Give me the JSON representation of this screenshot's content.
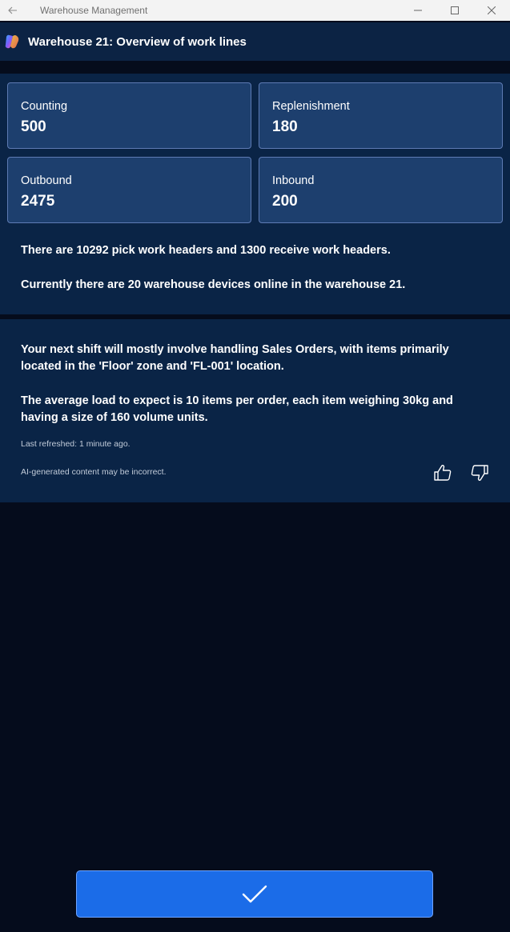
{
  "titlebar": {
    "title": "Warehouse Management",
    "back_icon": "arrow-left-icon",
    "minimize_icon": "minimize-icon",
    "maximize_icon": "maximize-icon",
    "close_icon": "close-icon"
  },
  "header": {
    "title": "Warehouse 21: Overview of work lines",
    "logo_icon": "copilot-logo"
  },
  "stats": [
    {
      "label": "Counting",
      "value": "500"
    },
    {
      "label": "Replenishment",
      "value": "180"
    },
    {
      "label": "Outbound",
      "value": "2475"
    },
    {
      "label": "Inbound",
      "value": "200"
    }
  ],
  "summary": {
    "line1": "There are 10292 pick work headers and 1300 receive work headers.",
    "line2": "Currently there are 20 warehouse devices online in the warehouse 21."
  },
  "insight": {
    "para1": "Your next shift will mostly involve handling Sales Orders, with items primarily located in the 'Floor' zone and 'FL-001' location.",
    "para2": "The average load to expect is 10 items per order, each item weighing 30kg and having a size of 160 volume units.",
    "last_refreshed": "Last refreshed: 1 minute ago.",
    "disclaimer": "AI-generated content may be incorrect.",
    "thumbs_up_icon": "thumbs-up-icon",
    "thumbs_down_icon": "thumbs-down-icon"
  },
  "confirm": {
    "icon": "checkmark-icon"
  },
  "colors": {
    "background": "#050c1c",
    "panel": "#0a2446",
    "card": "#1d3f6e",
    "card_border": "#5e7bb4",
    "button": "#1b6ce8"
  }
}
